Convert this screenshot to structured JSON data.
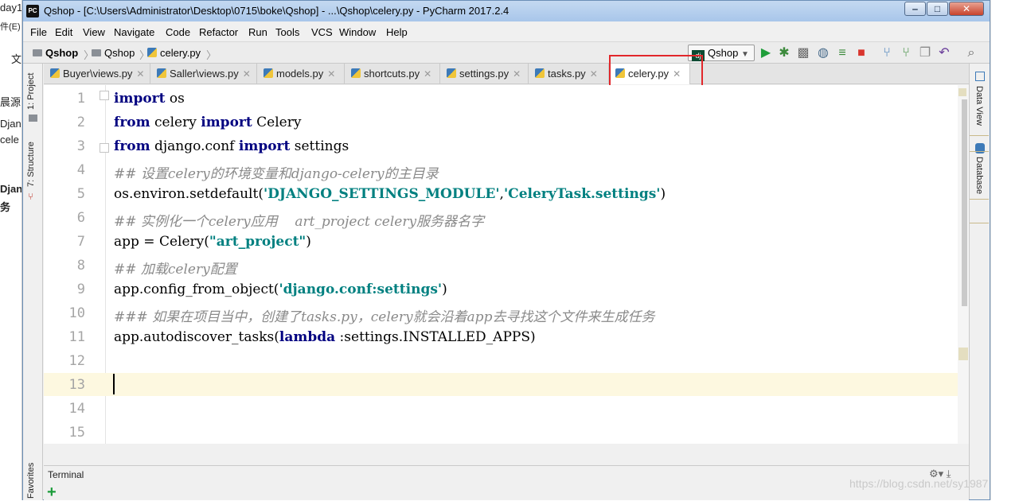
{
  "background_doc": {
    "fragments": [
      "day1",
      "件(E)",
      "文",
      "晨源",
      "Djan",
      "cele",
      "Djan",
      "务"
    ]
  },
  "window": {
    "title": "Qshop - [C:\\Users\\Administrator\\Desktop\\0715\\boke\\Qshop] - ...\\Qshop\\celery.py - PyCharm 2017.2.4",
    "app_icon": "PC"
  },
  "menubar": {
    "items": [
      {
        "label": "File"
      },
      {
        "label": "Edit"
      },
      {
        "label": "View"
      },
      {
        "label": "Navigate"
      },
      {
        "label": "Code"
      },
      {
        "label": "Refactor"
      },
      {
        "label": "Run"
      },
      {
        "label": "Tools"
      },
      {
        "label": "VCS"
      },
      {
        "label": "Window"
      },
      {
        "label": "Help"
      }
    ]
  },
  "navbar": {
    "breadcrumbs": [
      "Qshop",
      "Qshop",
      "celery.py"
    ],
    "run_config": "Qshop",
    "run_config_icon": "dj"
  },
  "left_tool_tabs": [
    "1: Project",
    "7: Structure",
    "Favorites"
  ],
  "right_tool_tabs": [
    "Data View",
    "Database"
  ],
  "tabs": [
    {
      "label": "Buyer\\views.py"
    },
    {
      "label": "Saller\\views.py"
    },
    {
      "label": "models.py"
    },
    {
      "label": "shortcuts.py"
    },
    {
      "label": "settings.py"
    },
    {
      "label": "tasks.py"
    },
    {
      "label": "celery.py",
      "active": true
    }
  ],
  "editor": {
    "current_line": 13,
    "lines": [
      {
        "n": "1",
        "parts": [
          {
            "t": "import",
            "c": "kw"
          },
          {
            "t": " os",
            "c": ""
          }
        ]
      },
      {
        "n": "2",
        "parts": [
          {
            "t": "from",
            "c": "kw"
          },
          {
            "t": " celery ",
            "c": ""
          },
          {
            "t": "import",
            "c": "kw"
          },
          {
            "t": " Celery",
            "c": ""
          }
        ]
      },
      {
        "n": "3",
        "parts": [
          {
            "t": "from",
            "c": "kw"
          },
          {
            "t": " django.conf ",
            "c": ""
          },
          {
            "t": "import",
            "c": "kw"
          },
          {
            "t": " settings",
            "c": ""
          }
        ]
      },
      {
        "n": "4",
        "parts": [
          {
            "t": "## 设置celery的环境变量和django-celery的主目录",
            "c": "cmt"
          }
        ]
      },
      {
        "n": "5",
        "parts": [
          {
            "t": "os.environ.setdefault(",
            "c": ""
          },
          {
            "t": "'DJANGO_SETTINGS_MODULE'",
            "c": "str"
          },
          {
            "t": ",",
            "c": ""
          },
          {
            "t": "'CeleryTask.settings'",
            "c": "str"
          },
          {
            "t": ")",
            "c": ""
          }
        ]
      },
      {
        "n": "6",
        "parts": [
          {
            "t": "## 实例化一个celery应用    art_project celery服务器名字",
            "c": "cmt"
          }
        ]
      },
      {
        "n": "7",
        "parts": [
          {
            "t": "app = Celery(",
            "c": ""
          },
          {
            "t": "\"art_project\"",
            "c": "str"
          },
          {
            "t": ")",
            "c": ""
          }
        ]
      },
      {
        "n": "8",
        "parts": [
          {
            "t": "## 加载celery配置",
            "c": "cmt"
          }
        ]
      },
      {
        "n": "9",
        "parts": [
          {
            "t": "app.config_from_object(",
            "c": ""
          },
          {
            "t": "'django.conf:settings'",
            "c": "str"
          },
          {
            "t": ")",
            "c": ""
          }
        ]
      },
      {
        "n": "10",
        "parts": [
          {
            "t": "### 如果在项目当中，创建了tasks.py，celery就会沿着app去寻找这个文件来生成任务",
            "c": "cmt"
          }
        ]
      },
      {
        "n": "11",
        "parts": [
          {
            "t": "app.autodiscover_tasks(",
            "c": ""
          },
          {
            "t": "lambda",
            "c": "kw"
          },
          {
            "t": " :settings.INSTALLED_APPS)",
            "c": ""
          }
        ]
      },
      {
        "n": "12",
        "parts": []
      },
      {
        "n": "13",
        "parts": []
      },
      {
        "n": "14",
        "parts": []
      },
      {
        "n": "15",
        "parts": []
      }
    ]
  },
  "terminal": {
    "title": "Terminal",
    "add_icon": "+"
  },
  "watermark": "https://blog.csdn.net/sy1987",
  "colors": {
    "keyword": "#000080",
    "string": "#008080",
    "comment": "#8a8a8a",
    "highlight_line": "#fdf8e0",
    "annotation_box": "#e2272b"
  }
}
